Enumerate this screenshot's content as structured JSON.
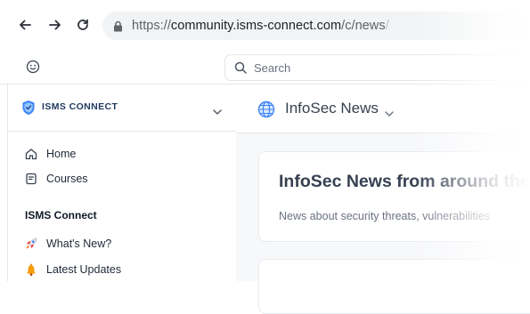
{
  "browser": {
    "url_prefix": "https://",
    "url_host": "community.isms-connect.com",
    "url_path": "/c/news",
    "url_tail": "/"
  },
  "header": {
    "search_placeholder": "Search"
  },
  "sidebar": {
    "brand": "ISMS CONNECT",
    "items": [
      {
        "label": "Home",
        "icon": "home-icon"
      },
      {
        "label": "Courses",
        "icon": "courses-icon"
      }
    ],
    "section_title": "ISMS Connect",
    "section_items": [
      {
        "label": "What's New?",
        "icon": "rocket-icon"
      },
      {
        "label": "Latest Updates",
        "icon": "bell-icon"
      }
    ]
  },
  "main": {
    "space_title": "InfoSec News",
    "card_title": "InfoSec News from around the",
    "card_description": "News about security threats, vulnerabilities"
  },
  "colors": {
    "brand_shield": "#3b82f6",
    "globe": "#3b82f6",
    "background": "#f7f8fa"
  }
}
